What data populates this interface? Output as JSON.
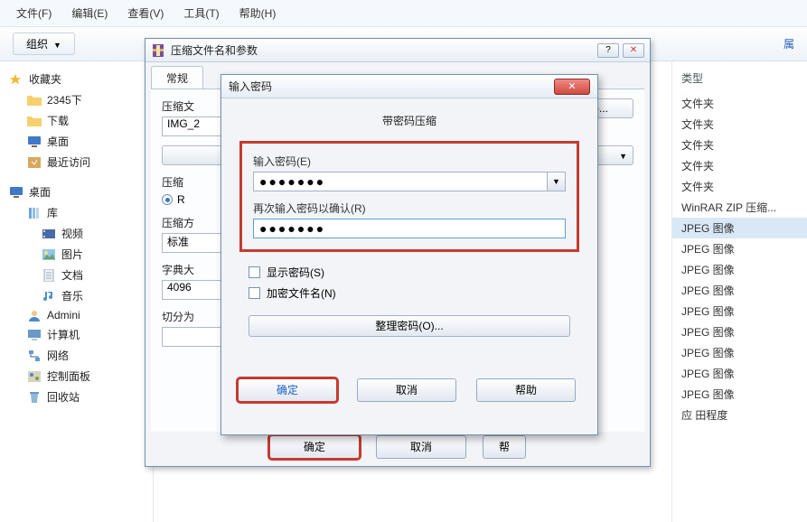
{
  "menu": {
    "file": "文件(F)",
    "edit": "编辑(E)",
    "view": "查看(V)",
    "tools": "工具(T)",
    "help": "帮助(H)"
  },
  "toolbar": {
    "organize": "组织",
    "attributes": "属"
  },
  "sidebar": {
    "favorites": "收藏夹",
    "folder1": "2345下",
    "downloads": "下载",
    "desktop": "桌面",
    "recent": "最近访问",
    "desktop2": "桌面",
    "library": "库",
    "videos": "视频",
    "pictures": "图片",
    "docs": "文档",
    "music": "音乐",
    "admini": "Admini",
    "computer": "计算机",
    "network": "网络",
    "control": "控制面板",
    "recycle": "回收站"
  },
  "right": {
    "head": "类型",
    "types": [
      "文件夹",
      "文件夹",
      "文件夹",
      "文件夹",
      "文件夹",
      "WinRAR ZIP 压缩...",
      "JPEG 图像",
      "JPEG 图像",
      "JPEG 图像",
      "JPEG 图像",
      "JPEG 图像",
      "JPEG 图像",
      "JPEG 图像",
      "JPEG 图像",
      "JPEG 图像",
      "应 田程度"
    ],
    "selected_index": 6
  },
  "dlg_outer": {
    "title": "压缩文件名和参数",
    "min": "─",
    "help_ctrl": "?",
    "close": "✕",
    "tab_general": "常规",
    "field_archive": "压缩文",
    "archive_value": "IMG_2",
    "browse": ")...",
    "update_combo_arrow": "▼",
    "method_label": "压缩",
    "method_radio": "R",
    "level_label": "压缩方",
    "level_value": "标准",
    "dict_label": "字典大",
    "dict_value": "4096",
    "split_label": "切分为",
    "ok": "确定",
    "cancel": "取消",
    "help": "帮"
  },
  "dlg_inner": {
    "title": "输入密码",
    "close": "✕",
    "heading": "带密码压缩",
    "pwd1_label": "输入密码(E)",
    "pwd1_value": "●●●●●●●",
    "pwd2_label": "再次输入密码以确认(R)",
    "pwd2_value": "●●●●●●●",
    "chk_show": "显示密码(S)",
    "chk_encrypt": "加密文件名(N)",
    "organize": "整理密码(O)...",
    "ok": "确定",
    "cancel": "取消",
    "help": "帮助"
  }
}
